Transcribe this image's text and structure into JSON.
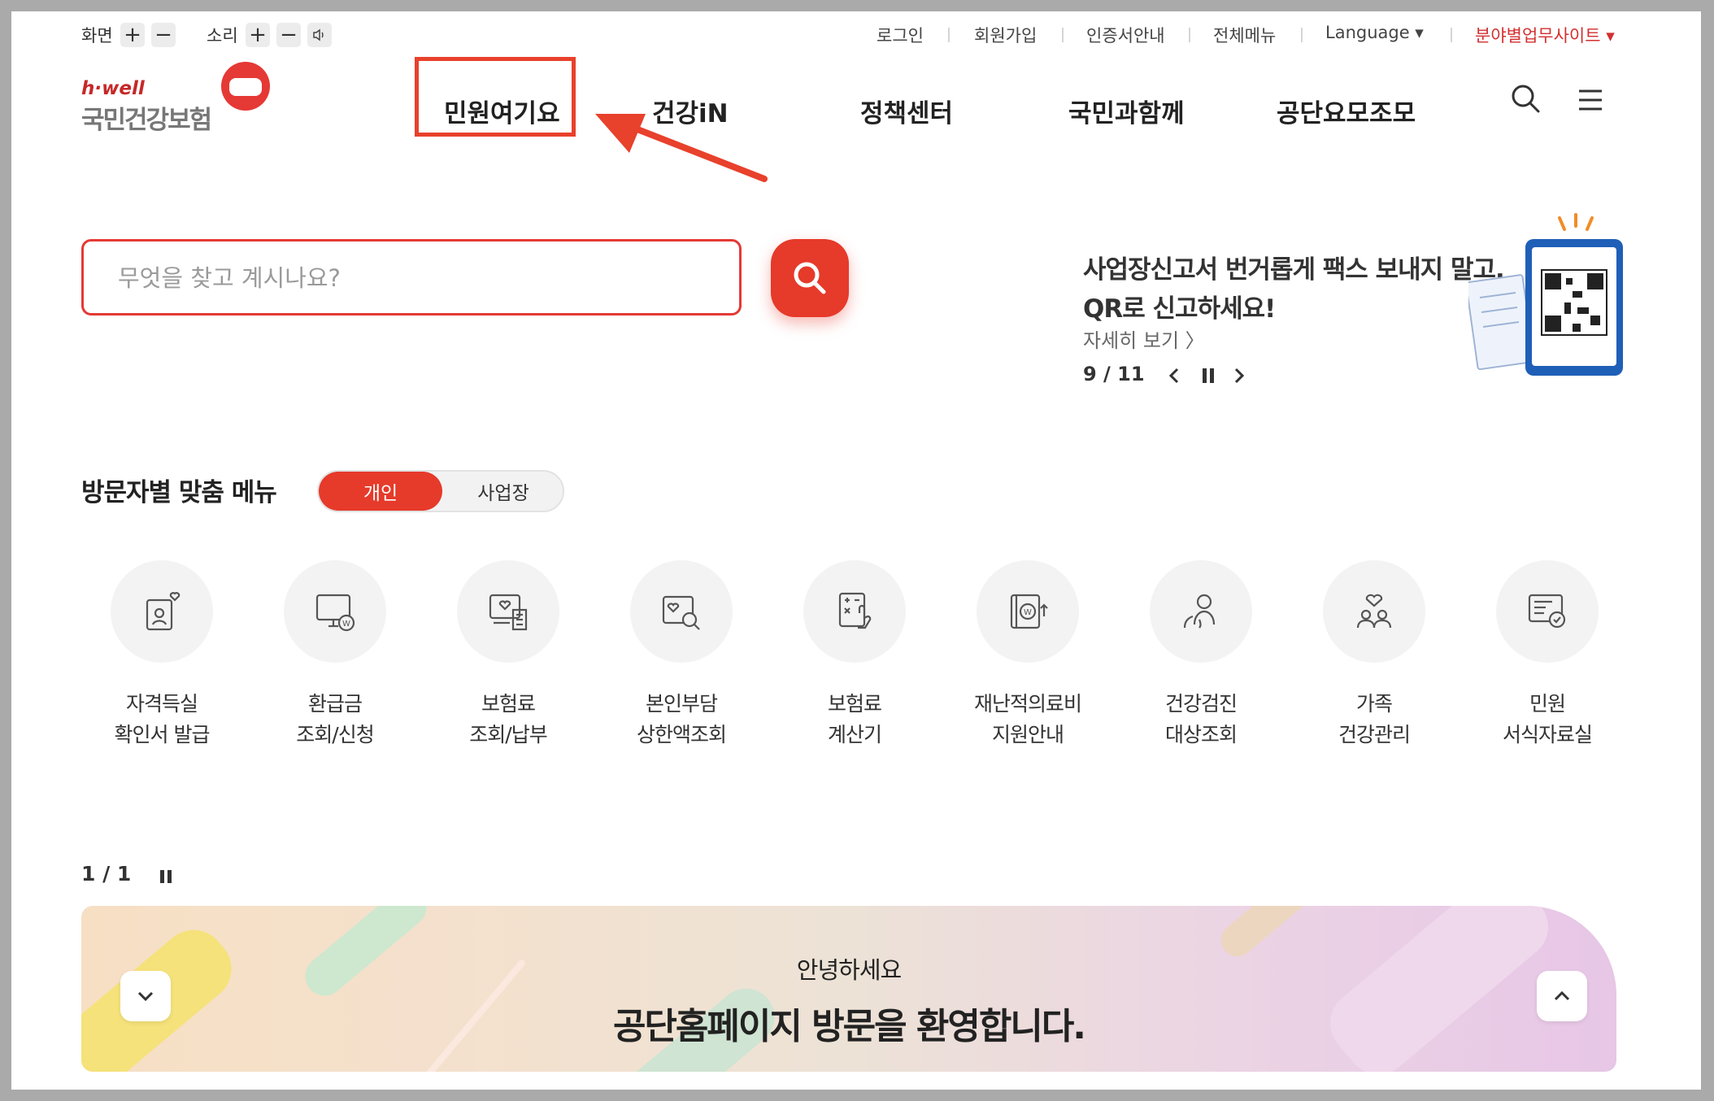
{
  "utility": {
    "screen_label": "화면",
    "sound_label": "소리",
    "plus": "+",
    "minus": "−",
    "links": [
      "로그인",
      "회원가입",
      "인증서안내",
      "전체메뉴"
    ],
    "language": "Language ▾",
    "field_sites": "분야별업무사이트 ▾"
  },
  "logo": {
    "brand": "h·well",
    "name": "국민건강보험"
  },
  "nav": {
    "items": [
      "민원여기요",
      "건강iN",
      "정책센터",
      "국민과함께",
      "공단요모조모"
    ],
    "highlight_color": "#e8412c"
  },
  "search": {
    "placeholder": "무엇을 찾고 계시나요?",
    "value": ""
  },
  "promo": {
    "line1": "사업장신고서 번거롭게 팩스 보내지 말고,",
    "line2": "QR로 신고하세요!",
    "more": "자세히 보기 〉",
    "counter": "9 / 11"
  },
  "visitor_menu": {
    "title": "방문자별 맞춤 메뉴",
    "tab_active": "개인",
    "tab_inactive": "사업장",
    "items": [
      {
        "line1": "자격득실",
        "line2": "확인서 발급",
        "icon": "id-card-heart-icon"
      },
      {
        "line1": "환급금",
        "line2": "조회/신청",
        "icon": "monitor-won-icon"
      },
      {
        "line1": "보험료",
        "line2": "조회/납부",
        "icon": "bill-heart-icon"
      },
      {
        "line1": "본인부담",
        "line2": "상한액조회",
        "icon": "card-search-icon"
      },
      {
        "line1": "보험료",
        "line2": "계산기",
        "icon": "calculator-hand-icon"
      },
      {
        "line1": "재난적의료비",
        "line2": "지원안내",
        "icon": "book-won-icon"
      },
      {
        "line1": "건강검진",
        "line2": "대상조회",
        "icon": "people-check-icon"
      },
      {
        "line1": "가족",
        "line2": "건강관리",
        "icon": "family-heart-icon"
      },
      {
        "line1": "민원",
        "line2": "서식자료실",
        "icon": "document-check-icon"
      }
    ],
    "pager": "1 / 1"
  },
  "banner": {
    "small": "안녕하세요",
    "big": "공단홈페이지 방문을 환영합니다."
  },
  "colors": {
    "accent": "#e63a2a",
    "text": "#222222",
    "chip": "#f3f3f3"
  }
}
